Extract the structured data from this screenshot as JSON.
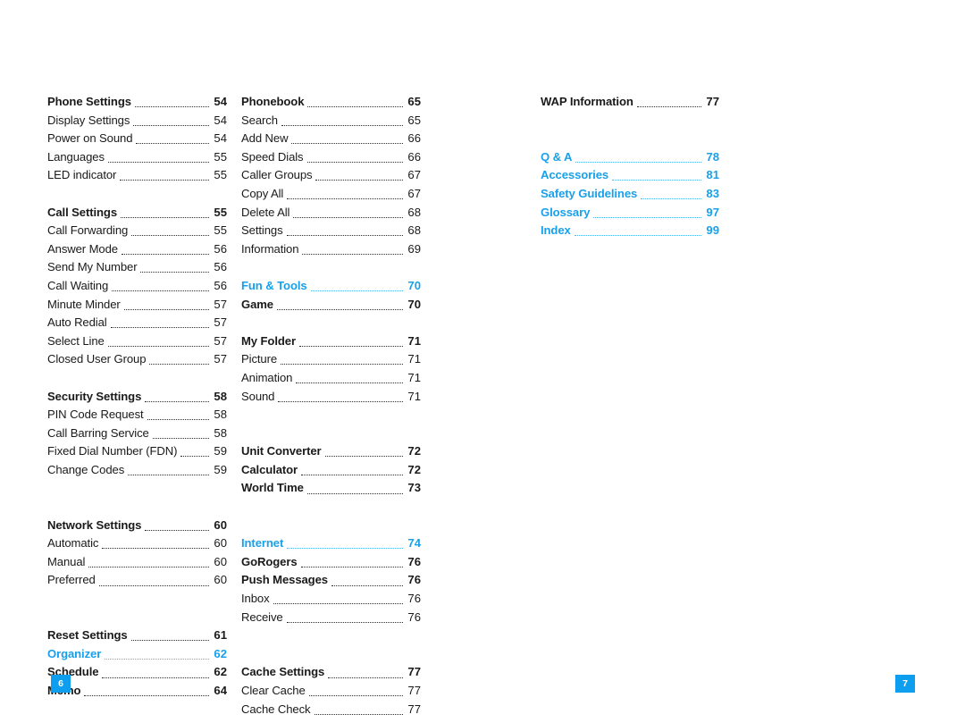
{
  "document": {
    "type": "table-of-contents",
    "accent_color": "#18a0ea",
    "text_color": "#1a1a1a",
    "badge_color": "#0d9ef0"
  },
  "left_page_number": "6",
  "right_page_number": "7",
  "columns": [
    {
      "name": "column-one",
      "entries": [
        {
          "label": "Phone Settings",
          "page": "54",
          "style": "bold"
        },
        {
          "label": "Display Settings",
          "page": "54",
          "style": "normal"
        },
        {
          "label": "Power on Sound",
          "page": "54",
          "style": "normal"
        },
        {
          "label": "Languages",
          "page": "55",
          "style": "normal"
        },
        {
          "label": "LED indicator",
          "page": "55",
          "style": "normal"
        },
        {
          "label": "",
          "page": "",
          "style": "spacer"
        },
        {
          "label": "Call Settings",
          "page": "55",
          "style": "bold"
        },
        {
          "label": "Call Forwarding",
          "page": "55",
          "style": "normal"
        },
        {
          "label": "Answer Mode",
          "page": "56",
          "style": "normal"
        },
        {
          "label": "Send My Number",
          "page": "56",
          "style": "normal"
        },
        {
          "label": "Call Waiting",
          "page": "56",
          "style": "normal"
        },
        {
          "label": "Minute Minder",
          "page": "57",
          "style": "normal"
        },
        {
          "label": "Auto Redial",
          "page": "57",
          "style": "normal"
        },
        {
          "label": "Select Line",
          "page": "57",
          "style": "normal"
        },
        {
          "label": "Closed User Group",
          "page": "57",
          "style": "normal"
        },
        {
          "label": "",
          "page": "",
          "style": "spacer"
        },
        {
          "label": "Security Settings",
          "page": "58",
          "style": "bold"
        },
        {
          "label": "PIN Code Request",
          "page": "58",
          "style": "normal"
        },
        {
          "label": "Call Barring Service",
          "page": "58",
          "style": "normal"
        },
        {
          "label": "Fixed Dial Number (FDN)",
          "page": "59",
          "style": "normal"
        },
        {
          "label": "Change Codes",
          "page": "59",
          "style": "normal"
        },
        {
          "label": "",
          "page": "",
          "style": "spacer"
        },
        {
          "label": "",
          "page": "",
          "style": "spacer"
        },
        {
          "label": "Network Settings",
          "page": "60",
          "style": "bold"
        },
        {
          "label": "Automatic",
          "page": "60",
          "style": "normal"
        },
        {
          "label": "Manual",
          "page": "60",
          "style": "normal"
        },
        {
          "label": "Preferred",
          "page": "60",
          "style": "normal"
        },
        {
          "label": "",
          "page": "",
          "style": "spacer"
        },
        {
          "label": "",
          "page": "",
          "style": "spacer"
        },
        {
          "label": "Reset Settings",
          "page": "61",
          "style": "bold"
        },
        {
          "label": "Organizer",
          "page": "62",
          "style": "blue"
        },
        {
          "label": "Schedule",
          "page": "62",
          "style": "bold"
        },
        {
          "label": "Memo",
          "page": "64",
          "style": "bold"
        }
      ]
    },
    {
      "name": "column-two",
      "entries": [
        {
          "label": "Phonebook",
          "page": "65",
          "style": "bold"
        },
        {
          "label": "Search",
          "page": "65",
          "style": "normal"
        },
        {
          "label": "Add New",
          "page": "66",
          "style": "normal"
        },
        {
          "label": "Speed Dials",
          "page": "66",
          "style": "normal"
        },
        {
          "label": "Caller Groups",
          "page": "67",
          "style": "normal"
        },
        {
          "label": "Copy All",
          "page": "67",
          "style": "normal"
        },
        {
          "label": "Delete All",
          "page": "68",
          "style": "normal"
        },
        {
          "label": "Settings",
          "page": "68",
          "style": "normal"
        },
        {
          "label": "Information",
          "page": "69",
          "style": "normal"
        },
        {
          "label": "",
          "page": "",
          "style": "spacer"
        },
        {
          "label": "Fun & Tools",
          "page": "70",
          "style": "blue"
        },
        {
          "label": "Game",
          "page": "70",
          "style": "bold"
        },
        {
          "label": "",
          "page": "",
          "style": "spacer"
        },
        {
          "label": "My Folder",
          "page": "71",
          "style": "bold"
        },
        {
          "label": "Picture",
          "page": "71",
          "style": "normal"
        },
        {
          "label": "Animation",
          "page": "71",
          "style": "normal"
        },
        {
          "label": "Sound",
          "page": "71",
          "style": "normal"
        },
        {
          "label": "",
          "page": "",
          "style": "spacer"
        },
        {
          "label": "",
          "page": "",
          "style": "spacer"
        },
        {
          "label": "Unit Converter",
          "page": "72",
          "style": "bold"
        },
        {
          "label": "Calculator",
          "page": "72",
          "style": "bold"
        },
        {
          "label": "World Time",
          "page": "73",
          "style": "bold"
        },
        {
          "label": "",
          "page": "",
          "style": "spacer"
        },
        {
          "label": "",
          "page": "",
          "style": "spacer"
        },
        {
          "label": "Internet",
          "page": "74",
          "style": "blue"
        },
        {
          "label": "GoRogers",
          "page": "76",
          "style": "bold"
        },
        {
          "label": "Push Messages",
          "page": "76",
          "style": "bold"
        },
        {
          "label": "Inbox",
          "page": "76",
          "style": "normal"
        },
        {
          "label": "Receive",
          "page": "76",
          "style": "normal"
        },
        {
          "label": "",
          "page": "",
          "style": "spacer"
        },
        {
          "label": "",
          "page": "",
          "style": "spacer"
        },
        {
          "label": "Cache Settings",
          "page": "77",
          "style": "bold"
        },
        {
          "label": "Clear Cache",
          "page": "77",
          "style": "normal"
        },
        {
          "label": "Cache Check",
          "page": "77",
          "style": "normal"
        }
      ]
    },
    {
      "name": "column-three",
      "entries": [
        {
          "label": "WAP Information",
          "page": "77",
          "style": "bold"
        },
        {
          "label": "",
          "page": "",
          "style": "spacer"
        },
        {
          "label": "",
          "page": "",
          "style": "spacer"
        },
        {
          "label": "Q & A",
          "page": "78",
          "style": "blue"
        },
        {
          "label": "Accessories",
          "page": "81",
          "style": "blue"
        },
        {
          "label": "Safety Guidelines",
          "page": "83",
          "style": "blue"
        },
        {
          "label": "Glossary",
          "page": "97",
          "style": "blue"
        },
        {
          "label": "Index",
          "page": "99",
          "style": "blue"
        }
      ]
    }
  ]
}
